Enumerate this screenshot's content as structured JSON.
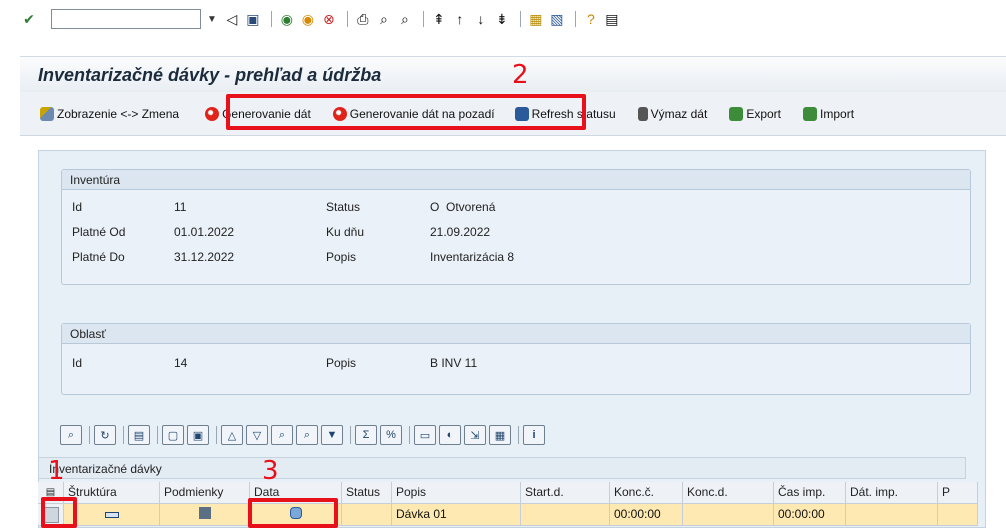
{
  "window": {
    "title": "Inventarizačné dávky - prehľad a údržba"
  },
  "toolbar": {
    "buttons": [
      {
        "label": "Zobrazenie <-> Zmena"
      },
      {
        "label": "Generovanie dát"
      },
      {
        "label": "Generovanie dát na pozadí"
      },
      {
        "label": "Refresh statusu"
      },
      {
        "label": "Výmaz dát"
      },
      {
        "label": "Export"
      },
      {
        "label": "Import"
      }
    ]
  },
  "inventura": {
    "title": "Inventúra",
    "fields": {
      "id_label": "Id",
      "id_value": "11",
      "od_label": "Platné Od",
      "od_value": "01.01.2022",
      "do_label": "Platné Do",
      "do_value": "31.12.2022",
      "status_label": "Status",
      "status_value": "O  Otvorená",
      "kudnu_label": "Ku dňu",
      "kudnu_value": "21.09.2022",
      "popis_label": "Popis",
      "popis_value": "Inventarizácia 8"
    }
  },
  "oblast": {
    "title": "Oblasť",
    "fields": {
      "id_label": "Id",
      "id_value": "14",
      "popis_label": "Popis",
      "popis_value": "B INV 11"
    }
  },
  "grid": {
    "title": "Inventarizačné dávky",
    "headers": [
      "Štruktúra",
      "Podmienky",
      "Data",
      "Status",
      "Popis",
      "Start.d.",
      "Konc.č.",
      "Konc.d.",
      "Čas imp.",
      "Dát. imp.",
      "P"
    ],
    "rows": [
      {
        "status": "",
        "popis": "Dávka 01",
        "start_d": "",
        "konc_c": "00:00:00",
        "konc_d": "",
        "cas_imp": "00:00:00",
        "dat_imp": "",
        "p": ""
      }
    ]
  },
  "annotations": {
    "one": "1",
    "two": "2",
    "three": "3"
  },
  "colors": {
    "highlight": "#e8101a",
    "row_selected": "#fde9b1",
    "panel": "#e8f0f7"
  }
}
